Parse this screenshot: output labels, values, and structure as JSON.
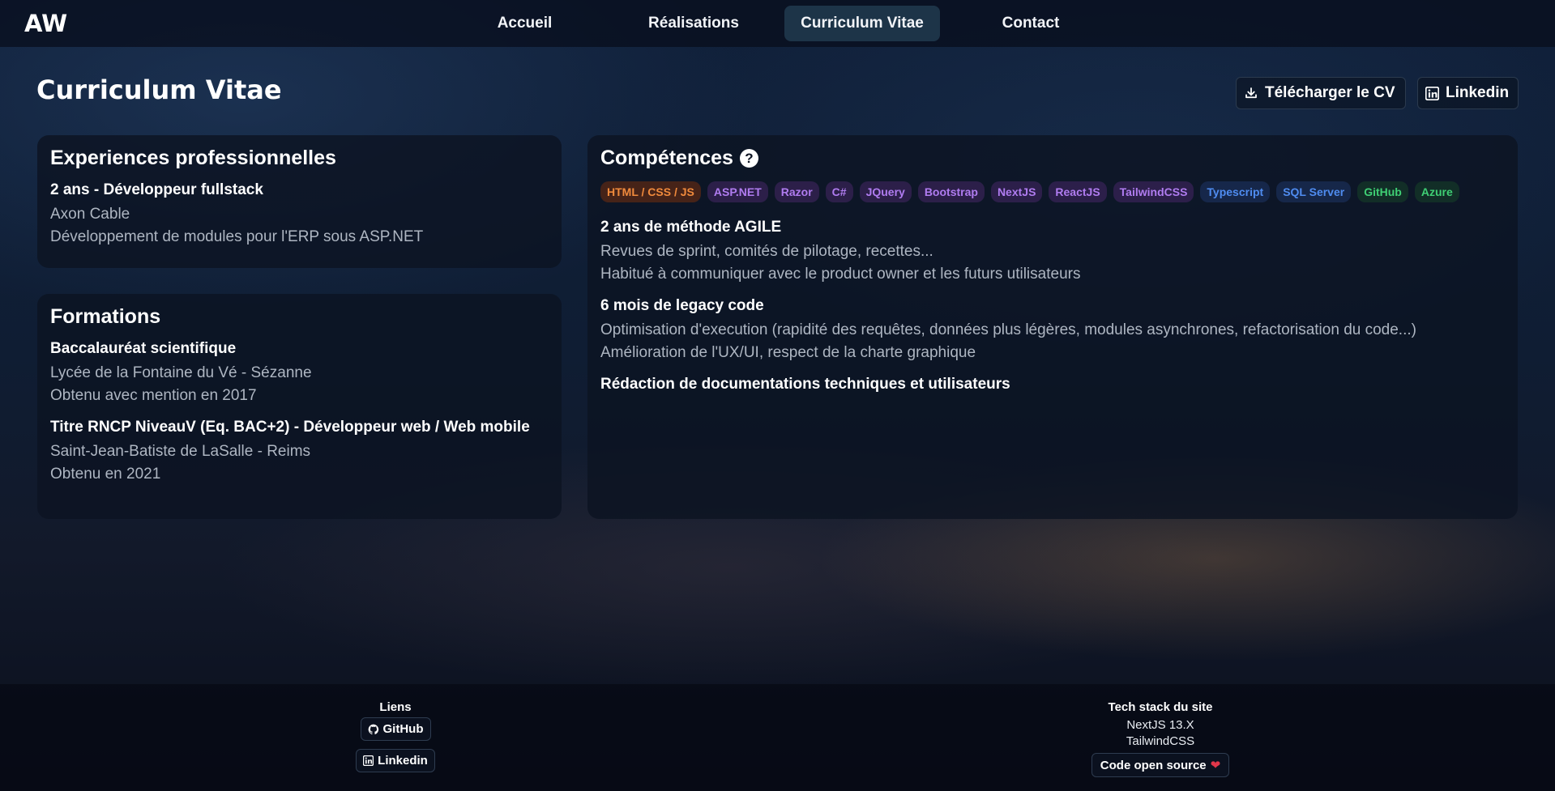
{
  "header": {
    "logo": "AW",
    "nav": [
      {
        "label": "Accueil"
      },
      {
        "label": "Réalisations"
      },
      {
        "label": "Curriculum Vitae"
      },
      {
        "label": "Contact"
      }
    ],
    "active_index": 2
  },
  "page": {
    "title": "Curriculum Vitae",
    "download_label": "Télécharger le CV",
    "linkedin_label": "Linkedin"
  },
  "experiences": {
    "heading": "Experiences professionnelles",
    "items": [
      {
        "title": "2 ans - Développeur fullstack",
        "lines": [
          "Axon Cable",
          "Développement de modules pour l'ERP sous ASP.NET"
        ]
      }
    ]
  },
  "formations": {
    "heading": "Formations",
    "items": [
      {
        "title": "Baccalauréat scientifique",
        "lines": [
          "Lycée de la Fontaine du Vé - Sézanne",
          "Obtenu avec mention en 2017"
        ]
      },
      {
        "title": "Titre RNCP NiveauV (Eq. BAC+2) - Développeur web / Web mobile",
        "lines": [
          "Saint-Jean-Batiste de LaSalle - Reims",
          "Obtenu en 2021"
        ]
      }
    ]
  },
  "competences": {
    "heading": "Compétences",
    "help_icon": "question-circle-icon",
    "tags": [
      {
        "label": "HTML / CSS / JS",
        "color": "orange"
      },
      {
        "label": "ASP.NET",
        "color": "purple"
      },
      {
        "label": "Razor",
        "color": "purple"
      },
      {
        "label": "C#",
        "color": "purple"
      },
      {
        "label": "JQuery",
        "color": "purple"
      },
      {
        "label": "Bootstrap",
        "color": "purple"
      },
      {
        "label": "NextJS",
        "color": "purple"
      },
      {
        "label": "ReactJS",
        "color": "purple"
      },
      {
        "label": "TailwindCSS",
        "color": "purple"
      },
      {
        "label": "Typescript",
        "color": "blue"
      },
      {
        "label": "SQL Server",
        "color": "blue"
      },
      {
        "label": "GitHub",
        "color": "green"
      },
      {
        "label": "Azure",
        "color": "green"
      }
    ],
    "items": [
      {
        "title": "2 ans de méthode AGILE",
        "lines": [
          "Revues de sprint, comités de pilotage, recettes...",
          "Habitué à communiquer avec le product owner et les futurs utilisateurs"
        ]
      },
      {
        "title": "6 mois de legacy code",
        "lines": [
          "Optimisation d'execution (rapidité des requêtes, données plus légères, modules asynchrones, refactorisation du code...)",
          "Amélioration de l'UX/UI, respect de la charte graphique"
        ]
      },
      {
        "title": "Rédaction de documentations techniques et utilisateurs",
        "lines": []
      }
    ]
  },
  "footer": {
    "links": {
      "title": "Liens",
      "github_label": "GitHub",
      "linkedin_label": "Linkedin"
    },
    "stack": {
      "title": "Tech stack du site",
      "lines": [
        "NextJS 13.X",
        "TailwindCSS"
      ],
      "open_source_label": "Code open source"
    }
  },
  "colors": {
    "tag_orange": "#f08a3c",
    "tag_purple": "#b07cf0",
    "tag_blue": "#4f8cf0",
    "tag_green": "#3fcf74",
    "heart": "#e0364a"
  }
}
